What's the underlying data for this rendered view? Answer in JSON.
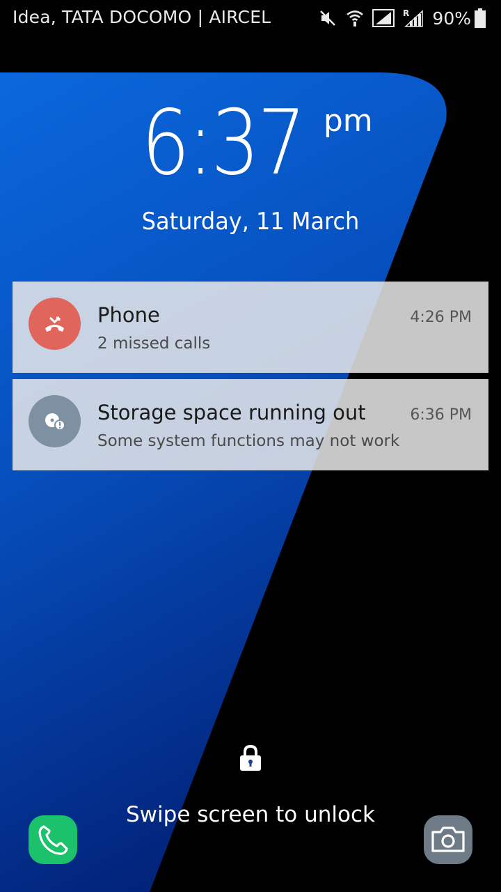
{
  "status_bar": {
    "carrier": "Idea, TATA DOCOMO | AIRCEL",
    "battery": "90%",
    "icons": [
      "mute-icon",
      "wifi-icon",
      "signal-icon",
      "roaming-signal-icon",
      "battery-icon"
    ]
  },
  "lockscreen": {
    "time": "6:37",
    "ampm": "pm",
    "date": "Saturday, 11 March"
  },
  "notifications": [
    {
      "app": "Phone",
      "text": "2 missed calls",
      "time": "4:26 PM",
      "icon": "missed-call-icon",
      "icon_color": "#e0655a"
    },
    {
      "app": "Storage space running out",
      "text": "Some system functions may not work",
      "time": "6:36 PM",
      "icon": "storage-warning-icon",
      "icon_color": "#7d91a3"
    }
  ],
  "unlock": {
    "hint": "Swipe screen to unlock",
    "icon": "lock-icon"
  },
  "shortcuts": {
    "left": {
      "icon": "phone-icon",
      "color": "#1bc16b"
    },
    "right": {
      "icon": "camera-icon",
      "color": "#6e7a86"
    }
  },
  "colors": {
    "wallpaper_blue": "#0a5fd0",
    "wallpaper_dark_blue": "#032f8a",
    "background": "#000000"
  }
}
